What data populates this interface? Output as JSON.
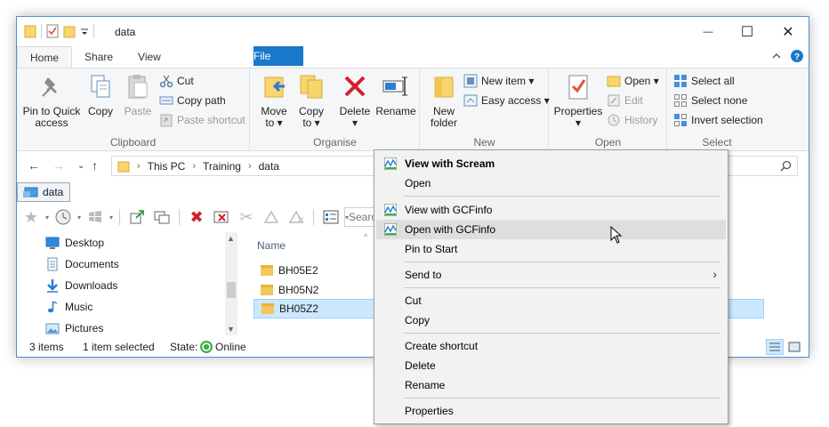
{
  "window": {
    "title": "data",
    "controls": {
      "minimize": "—",
      "maximize": "☐",
      "close": "✕"
    }
  },
  "ribbon_tabs": [
    "File",
    "Home",
    "Share",
    "View"
  ],
  "ribbon": {
    "clipboard": {
      "label": "Clipboard",
      "pin_line1": "Pin to Quick",
      "pin_line2": "access",
      "copy": "Copy",
      "paste": "Paste",
      "cut": "Cut",
      "copy_path": "Copy path",
      "paste_shortcut": "Paste shortcut"
    },
    "organise": {
      "label": "Organise",
      "move_line1": "Move",
      "move_line2": "to ▾",
      "copyto_line1": "Copy",
      "copyto_line2": "to ▾",
      "delete_line1": "Delete",
      "delete_line2": "▾",
      "rename": "Rename"
    },
    "new": {
      "label": "New",
      "new_folder_line1": "New",
      "new_folder_line2": "folder",
      "new_item": "New item ▾",
      "easy_access": "Easy access ▾"
    },
    "open": {
      "label": "Open",
      "properties_line1": "Properties",
      "properties_line2": "▾",
      "open": "Open ▾",
      "edit": "Edit",
      "history": "History"
    },
    "select": {
      "label": "Select",
      "select_all": "Select all",
      "select_none": "Select none",
      "invert": "Invert selection"
    }
  },
  "address": {
    "crumbs": [
      "This PC",
      "Training",
      "data"
    ]
  },
  "chip_label": "data",
  "toolbar_search_placeholder": "Search",
  "nav_pane": [
    "Desktop",
    "Documents",
    "Downloads",
    "Music",
    "Pictures"
  ],
  "file_list": {
    "column_name": "Name",
    "files": [
      "BH05E2",
      "BH05N2",
      "BH05Z2"
    ],
    "selected_index": 2
  },
  "status": {
    "items": "3 items",
    "selected": "1 item selected",
    "state_label": "State:",
    "state_value": "Online"
  },
  "context_menu": {
    "view_scream": "View with Scream",
    "open": "Open",
    "view_gcf": "View with GCFinfo",
    "open_gcf": "Open with GCFinfo",
    "pin_start": "Pin to Start",
    "send_to": "Send to",
    "cut": "Cut",
    "copy": "Copy",
    "create_shortcut": "Create shortcut",
    "delete": "Delete",
    "rename": "Rename",
    "properties": "Properties"
  }
}
